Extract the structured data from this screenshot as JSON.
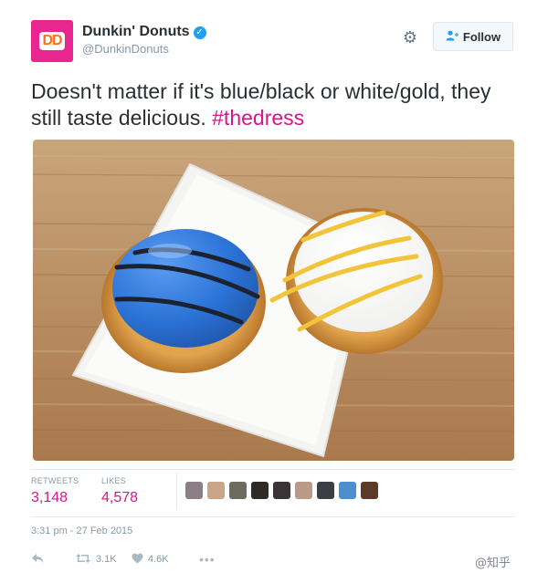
{
  "header": {
    "display_name": "Dunkin' Donuts",
    "handle": "@DunkinDonuts",
    "avatar_text": "DD",
    "follow_label": "Follow"
  },
  "tweet": {
    "text_before": "Doesn't matter if it's blue/black or white/gold, they still taste delicious. ",
    "hashtag": "#thedress"
  },
  "stats": {
    "retweets_label": "RETWEETS",
    "retweets_value": "3,148",
    "likes_label": "LIKES",
    "likes_value": "4,578",
    "liker_colors": [
      "#8a7f85",
      "#c9a58a",
      "#6b6b5f",
      "#2f2a26",
      "#3a3436",
      "#b99a86",
      "#3b3e44",
      "#4c8fcf",
      "#5b3a2a"
    ]
  },
  "timestamp": "3:31 pm - 27 Feb 2015",
  "actions": {
    "retweet_count": "3.1K",
    "like_count": "4.6K"
  },
  "watermark": "@知乎",
  "colors": {
    "accent": "#d6168a",
    "blue_glaze": "#2b72d6",
    "verified": "#1da1f2"
  }
}
